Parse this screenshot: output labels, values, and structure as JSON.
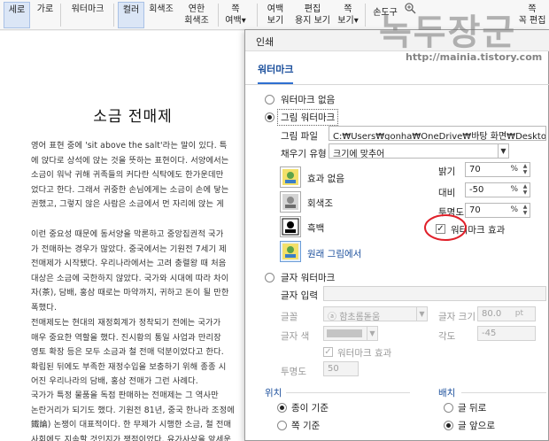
{
  "ribbon": {
    "portrait": "세로",
    "landscape": "가로",
    "watermark": "워터마크",
    "color": "컬러",
    "grayscale": "회색조",
    "light_gray_1": "연한",
    "light_gray_2": "회색조",
    "page_margin_1": "쪽",
    "page_margin_2": "여백",
    "margin_view_1": "여백",
    "margin_view_2": "보기",
    "edit_paper_1": "편집",
    "edit_paper_2": "용지 보기",
    "page_view_1": "쪽",
    "page_view_2": "보기",
    "hand_tool": "손도구",
    "page_edit_1": "쪽",
    "page_edit_2": "꼭 편집"
  },
  "document": {
    "title": "소금 전매제",
    "p1": "영어 표현 중에 'sit above the salt'라는 말이 있다. 특\n에 앉다로 상석에 앉는 것을 뜻하는 표현이다. 서양에서는\n소금이 워낙 귀해 귀족들의 커다란 식탁에도 한가운데만\n었다고 한다. 그래서 귀중한 손님에게는 소금이 손에 닿는\n권했고, 그렇지 않은 사람은 소금에서 먼 자리에 앉는 게",
    "p2": "이런 중요성 때문에 동서양을 막론하고 중앙집권적 국가\n가 전매하는 경우가 많았다. 중국에서는 기원전 7세기 제\n전매제가 시작됐다. 우리나라에서는 고려 충렬왕 때 처음\n대상은 소금에 국한하지 않았다. 국가와 시대에 따라 차이\n자(茶), 담배, 홍삼 때로는 마약까지, 귀하고 돈이 될 만한\n폭했다.",
    "p3": "전매제도는 현대의 재정회계가 정착되기 전에는 국가가\n매우 중요한 역할을 했다. 진시황의 통일 사업과 만리장\n영토 확장 등은 모두 소금과 철 전매 덕분이었다고 한다.\n확립된 뒤에도 부족한 재정수입을 보충하기 위해 종종 시\n어진 우리나라의 담배, 홍삼 전매가 그런 사례다.",
    "p4": "국가가 특정 물품을 독점 판매하는 전매제는 그 역사만\n논란거리가 되기도 했다. 기원전 81년, 중국 한나라 조정에\n鐵論) 논쟁이 대표적이다. 한 무제가 시행한 소금, 철 전매\n사회에도 지속할 것인지가 쟁점이었다. 유가사상을 앞세운"
  },
  "dialog": {
    "title": "인쇄",
    "tab": "워터마크",
    "no_watermark": "워터마크 없음",
    "image_watermark": "그림 워터마크",
    "image_file_label": "그림 파일",
    "image_file_value": "C:₩Users₩gonha₩OneDrive₩바탕 화면₩Desktop₩",
    "fill_type_label": "채우기 유형",
    "fill_type_value": "크기에 맞추어",
    "effect_none": "효과 없음",
    "effect_gray": "회색조",
    "effect_bw": "흑백",
    "original_image": "원래 그림에서",
    "brightness_label": "밝기",
    "brightness_value": "70",
    "contrast_label": "대비",
    "contrast_value": "-50",
    "transparency_label": "투명도",
    "transparency_value": "70",
    "percent": "%",
    "watermark_effect": "워터마크 효과",
    "text_watermark": "글자 워터마크",
    "text_input_label": "글자 입력",
    "font_label": "글꼴",
    "font_value": "함초롬돋움",
    "font_size_label": "글자 크기",
    "font_size_value": "80.0",
    "font_size_unit": "pt",
    "text_color_label": "글자 색",
    "angle_label": "각도",
    "angle_value": "-45",
    "text_wm_effect": "워터마크 효과",
    "text_transparency_label": "투명도",
    "text_transparency_value": "50",
    "position_section": "위치",
    "pos_paper": "종이 기준",
    "pos_page": "쪽 기준",
    "arrange_section": "배치",
    "arr_behind": "글 뒤로",
    "arr_front": "글 앞으로"
  },
  "overlay": {
    "watermark_text": "녹두장군",
    "site_url": "http://mainia.tistory.com"
  },
  "colors": {
    "accent": "#2f6fd0",
    "highlight_circle": "#e0202a"
  }
}
